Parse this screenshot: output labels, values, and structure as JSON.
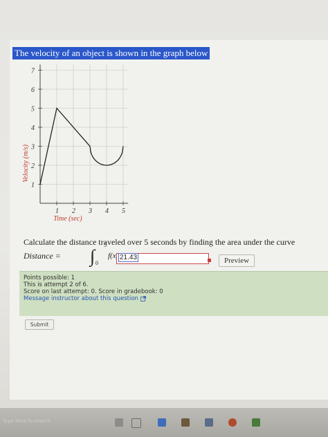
{
  "question": {
    "title": "The velocity of an object is shown in the graph below",
    "prompt": "Calculate the distance traveled over 5 seconds by finding the area under the curve",
    "distance_label": "Distance =",
    "integral_symbol": "∫",
    "upper_bound": "5",
    "lower_bound": "0",
    "integrand": "f(x)dx=",
    "answer_value": "21.43",
    "preview_label": "Preview"
  },
  "chart_data": {
    "type": "line",
    "xlabel": "Time (sec)",
    "ylabel": "Velocity (m/s)",
    "xlim": [
      0,
      5
    ],
    "ylim": [
      0,
      7
    ],
    "x_ticks": [
      "1",
      "2",
      "3",
      "4",
      "5"
    ],
    "y_ticks": [
      "1",
      "2",
      "3",
      "4",
      "5",
      "6",
      "7"
    ],
    "grid": true,
    "segments": [
      {
        "kind": "line",
        "points": [
          [
            0,
            1
          ],
          [
            1,
            5
          ],
          [
            3,
            3
          ]
        ]
      },
      {
        "kind": "semicircle",
        "center": [
          4,
          3
        ],
        "radius": 1,
        "direction": "down"
      }
    ]
  },
  "info": {
    "points_possible": "Points possible: 1",
    "attempt": "This is attempt 2 of 6.",
    "score": "Score on last attempt: 0. Score in gradebook: 0",
    "message_link": "Message instructor about this question",
    "message_icon": "external-link-icon"
  },
  "submit_label": "Submit",
  "taskbar": {
    "search_hint": "Type here to search"
  },
  "colors": {
    "title_bg": "#2a57c9",
    "curve": "#222222",
    "axis_label": "#c0392b",
    "info_bg": "#cfe0c2",
    "link": "#2855b0",
    "error": "#d23c3c"
  }
}
